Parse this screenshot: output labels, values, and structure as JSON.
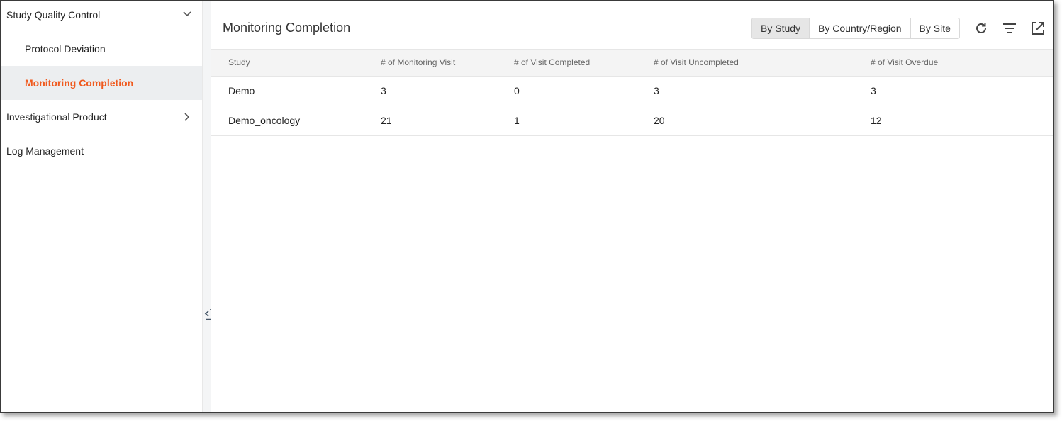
{
  "sidebar": {
    "items": [
      {
        "label": "Study Quality Control",
        "expanded": true
      },
      {
        "label": "Protocol Deviation"
      },
      {
        "label": "Monitoring Completion",
        "active": true
      },
      {
        "label": "Investigational Product",
        "expanded": false
      },
      {
        "label": "Log Management"
      }
    ]
  },
  "main": {
    "title": "Monitoring Completion",
    "view_toggle": {
      "options": [
        "By Study",
        "By Country/Region",
        "By Site"
      ],
      "selected": "By Study"
    },
    "toolbar_icons": [
      "refresh-icon",
      "filter-icon",
      "external-link-icon"
    ],
    "table": {
      "columns": [
        "Study",
        "# of Monitoring Visit",
        "# of Visit Completed",
        "# of Visit Uncompleted",
        "# of Visit Overdue"
      ],
      "rows": [
        [
          "Demo",
          "3",
          "0",
          "3",
          "3"
        ],
        [
          "Demo_oncology",
          "21",
          "1",
          "20",
          "12"
        ]
      ]
    }
  },
  "colors": {
    "accent": "#f05a1e",
    "active_bg": "#eceef0",
    "header_bg": "#f4f4f4",
    "selected_toggle_bg": "#e6e6e6"
  }
}
